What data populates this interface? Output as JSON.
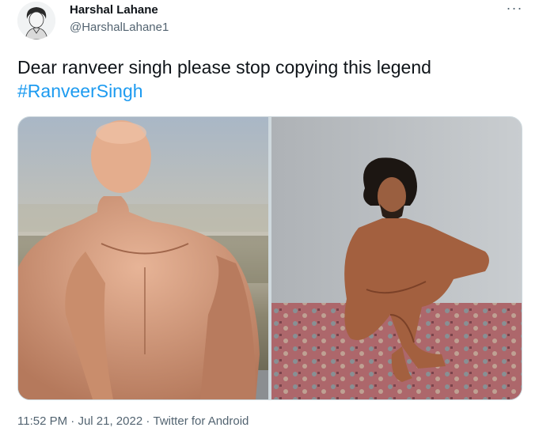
{
  "tweet": {
    "author_name": "Harshal Lahane",
    "author_handle": "@HarshalLahane1",
    "text": "Dear ranveer singh please stop copying this legend",
    "hashtag": "#RanveerSingh",
    "time": "11:52 PM",
    "separator1": "·",
    "date": "Jul 21, 2022",
    "separator2": "·",
    "source": "Twitter for Android",
    "more_icon": "more-horizontal-icon",
    "hashtag_color": "#1d9bf0"
  }
}
